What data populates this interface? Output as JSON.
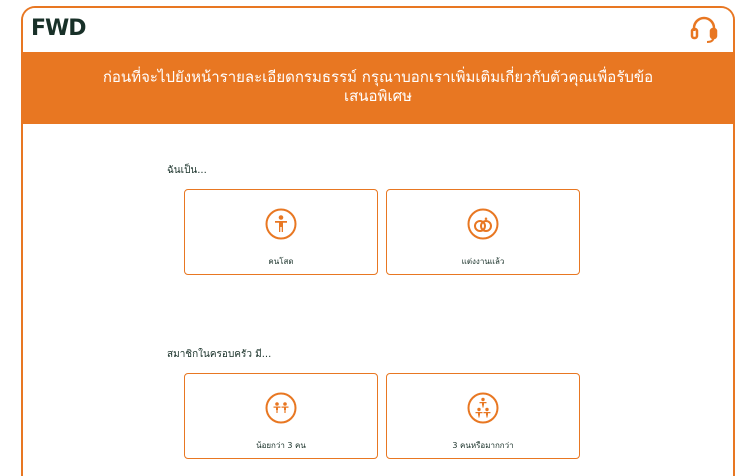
{
  "header": {
    "logo_text": "FWD",
    "support_icon": "headset-icon"
  },
  "banner": {
    "line1": "ก่อนที่จะไปยังหน้ารายละเอียดกรมธรรม์ กรุณาบอกเราเพิ่มเติมเกี่ยวกับตัวคุณเพื่อรับข้อ",
    "line2": "เสนอพิเศษ"
  },
  "marital": {
    "label": "ฉันเป็น...",
    "options": [
      {
        "label": "คนโสด",
        "icon": "single-person-icon"
      },
      {
        "label": "แต่งงานแล้ว",
        "icon": "wedding-rings-icon"
      }
    ]
  },
  "family": {
    "label": "สมาชิกในครอบครัว มี...",
    "options": [
      {
        "label": "น้อยกว่า 3 คน",
        "icon": "two-people-icon"
      },
      {
        "label": "3 คนหรือมากกว่า",
        "icon": "family-icon"
      }
    ]
  },
  "colors": {
    "brand_orange": "#e87722",
    "text_dark": "#183028"
  }
}
